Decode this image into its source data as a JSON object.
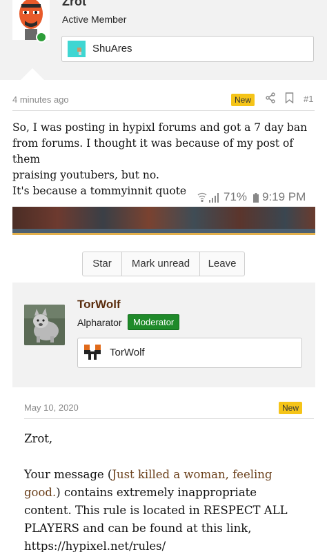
{
  "post1": {
    "username": "Zrot",
    "role": "Active Member",
    "signature": "ShuAres",
    "time": "4 minutes ago",
    "badge": "New",
    "number": "#1",
    "body": [
      "So, I was posting in hypixl forums and got a 7 day ban",
      "from forums. I thought it was because of my post of them",
      "praising youtubers, but no.",
      "It's because a tommyinnit quote"
    ]
  },
  "statusbar": {
    "battery": "71%",
    "time": "9:19 PM"
  },
  "thread_buttons": [
    "Star",
    "Mark unread",
    "Leave"
  ],
  "post2": {
    "username": "TorWolf",
    "role": "Alpharator",
    "badge_role": "Moderator",
    "signature": "TorWolf",
    "date": "May 10, 2020",
    "badge": "New",
    "greeting": "Zrot,",
    "message_pre": "Your message (",
    "message_link": "Just killed a woman, feeling good.",
    "message_post": ") contains extremely inappropriate content. This rule is located in RESPECT ALL PLAYERS and can be found at this link,",
    "url": "https://hypixel.net/rules/"
  },
  "colors": {
    "new_badge": "#f5c418",
    "moderator_badge": "#1f8a2a",
    "username_brown": "#5a2d0e",
    "online": "#2e9e3a"
  }
}
